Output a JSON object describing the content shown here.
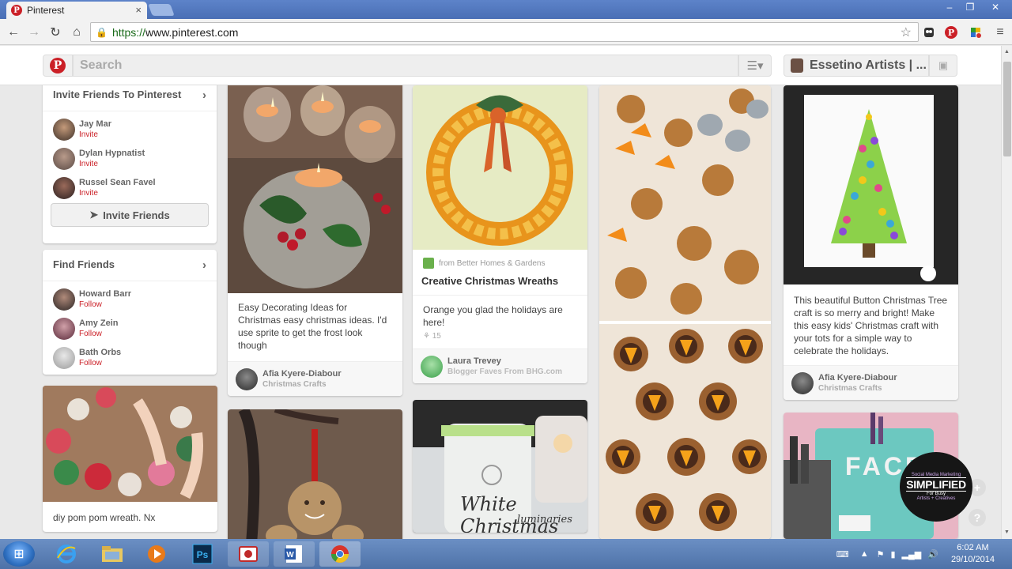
{
  "browser": {
    "tab_title": "Pinterest",
    "tab_close": "×",
    "url_scheme": "https://",
    "url_host": "www.pinterest.com",
    "controls": {
      "minimize": "–",
      "restore": "❐",
      "close": "✕"
    }
  },
  "header": {
    "search_placeholder": "Search",
    "user_name": "Essetino Artists | ..."
  },
  "sidebar": {
    "invite_panel": {
      "title": "Invite Friends To Pinterest",
      "friends": [
        {
          "name": "Jay Mar",
          "action": "Invite"
        },
        {
          "name": "Dylan Hypnatist",
          "action": "Invite"
        },
        {
          "name": "Russel Sean Favel",
          "action": "Invite"
        }
      ],
      "button_label": "Invite Friends"
    },
    "find_panel": {
      "title": "Find Friends",
      "friends": [
        {
          "name": "Howard Barr",
          "action": "Follow"
        },
        {
          "name": "Amy Zein",
          "action": "Follow"
        },
        {
          "name": "Bath Orbs",
          "action": "Follow"
        }
      ]
    },
    "pom_pin": {
      "description": "diy pom pom wreath. Nx"
    }
  },
  "pins": {
    "candles": {
      "description": "Easy Decorating Ideas for Christmas easy christmas ideas. I'd use sprite to get the frost look though",
      "pinner": "Afia Kyere-Diabour",
      "board": "Christmas Crafts"
    },
    "wreath": {
      "source": "from Better Homes & Gardens",
      "title": "Creative Christmas Wreaths",
      "description": "Orange you glad the holidays are here!",
      "repins": "15",
      "pinner": "Laura Trevey",
      "board": "Blogger Faves From BHG.com"
    },
    "button_tree": {
      "description": "This beautiful Button Christmas Tree craft is so merry and bright! Make this easy kids' Christmas craft with your tots for a simple way to celebrate the holidays.",
      "pinner": "Afia Kyere-Diabour",
      "board": "Christmas Crafts"
    },
    "luminaries": {
      "overlay_line1": "White Christmas",
      "overlay_line2": "luminaries"
    },
    "face_cart": {
      "overlay": "FACE"
    }
  },
  "badge": {
    "line1": "Social Media Marketing",
    "line2": "SIMPLIFIED",
    "line3": "For Busy",
    "line4": "Artists + Creatives"
  },
  "float_buttons": {
    "plus": "+",
    "help": "?"
  },
  "taskbar": {
    "time": "6:02 AM",
    "date": "29/10/2014"
  },
  "colors": {
    "brand": "#cb2027",
    "accent_green": "#1a6b1a"
  }
}
